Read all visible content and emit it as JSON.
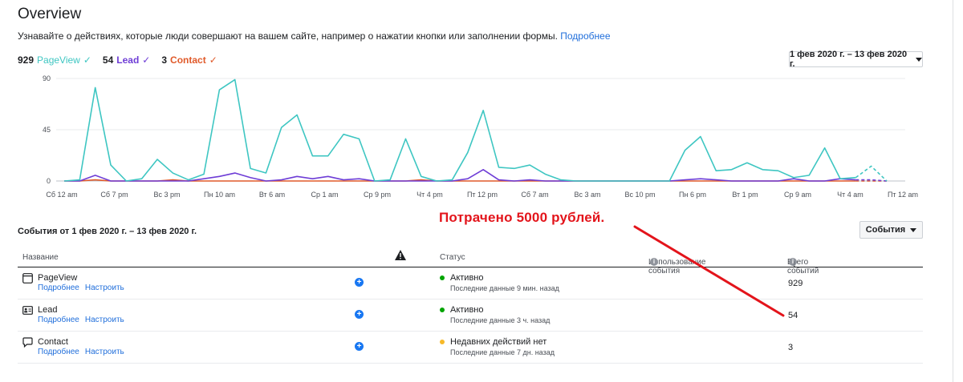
{
  "header": {
    "title": "Overview",
    "subtitle": "Узнавайте о действиях, которые люди совершают на вашем сайте, например о нажатии кнопки или заполнении формы.",
    "more_link": "Подробнее"
  },
  "legend": [
    {
      "count": "929",
      "name": "PageView",
      "check": "✓",
      "color": "#3ec6c2"
    },
    {
      "count": "54",
      "name": "Lead",
      "check": "✓",
      "color": "#6e3dd6"
    },
    {
      "count": "3",
      "name": "Contact",
      "check": "✓",
      "color": "#e05a2a"
    }
  ],
  "date_range": {
    "label": "1 фев 2020 г. – 13 фев 2020 г."
  },
  "chart_data": {
    "type": "line",
    "x_tick_labels": [
      "Сб 12 am",
      "Сб 7 pm",
      "Вс 3 pm",
      "Пн 10 am",
      "Вт 6 am",
      "Ср 1 am",
      "Ср 9 pm",
      "Чт 4 pm",
      "Пт 12 pm",
      "Сб 7 am",
      "Вс 3 am",
      "Вс 10 pm",
      "Пн 6 pm",
      "Вт 1 pm",
      "Ср 9 am",
      "Чт 4 am",
      "Пт 12 am"
    ],
    "y_ticks": [
      0,
      45,
      90
    ],
    "ylim": [
      0,
      90
    ],
    "series": [
      {
        "name": "PageView",
        "color": "#3ec6c2",
        "values": [
          0,
          1,
          82,
          14,
          0,
          2,
          19,
          7,
          1,
          6,
          80,
          89,
          11,
          7,
          47,
          58,
          22,
          22,
          41,
          37,
          0,
          1,
          37,
          4,
          0,
          1,
          25,
          62,
          12,
          11,
          14,
          6,
          1,
          0,
          0,
          0,
          0,
          0,
          0,
          0,
          27,
          39,
          9,
          10,
          16,
          10,
          9,
          3,
          5,
          29,
          2,
          3,
          13,
          0
        ],
        "dashed_from": 51
      },
      {
        "name": "Lead",
        "color": "#6e3dd6",
        "values": [
          0,
          0,
          5,
          0,
          0,
          0,
          0,
          0,
          0,
          2,
          4,
          7,
          3,
          0,
          1,
          4,
          2,
          4,
          1,
          2,
          0,
          0,
          0,
          0,
          0,
          0,
          2,
          10,
          1,
          0,
          1,
          0,
          0,
          0,
          0,
          0,
          0,
          0,
          0,
          0,
          1,
          2,
          1,
          0,
          0,
          0,
          0,
          2,
          0,
          0,
          2,
          1,
          1,
          0
        ],
        "dashed_from": 51
      },
      {
        "name": "Contact",
        "color": "#e05a2a",
        "values": [
          0,
          0,
          1,
          0,
          0,
          0,
          0,
          1,
          0,
          0,
          0,
          0,
          0,
          0,
          0,
          0,
          0,
          0,
          0,
          0,
          0,
          0,
          0,
          1,
          0,
          0,
          0,
          0,
          0,
          0,
          0,
          0,
          0,
          0,
          0,
          0,
          0,
          0,
          0,
          0,
          0,
          0,
          0,
          0,
          0,
          0,
          0,
          0,
          0,
          0,
          0,
          0,
          0,
          0
        ],
        "dashed_from": 51
      }
    ],
    "grid": true
  },
  "events": {
    "heading": "События от 1 фев 2020 г. – 13 фев 2020 г.",
    "button_label": "События",
    "columns": {
      "name": "Название",
      "status": "Статус",
      "usage": "Использование события",
      "total": "Всего событий"
    },
    "rows": [
      {
        "name": "PageView",
        "link_more": "Подробнее",
        "link_setup": "Настроить",
        "status": "Активно",
        "status_color": "#00a400",
        "status_sub": "Последние данные 9 мин. назад",
        "total": "929",
        "icon": "page-icon"
      },
      {
        "name": "Lead",
        "link_more": "Подробнее",
        "link_setup": "Настроить",
        "status": "Активно",
        "status_color": "#00a400",
        "status_sub": "Последние данные 3 ч. назад",
        "total": "54",
        "icon": "contact-card-icon"
      },
      {
        "name": "Contact",
        "link_more": "Подробнее",
        "link_setup": "Настроить",
        "status": "Недавних действий нет",
        "status_color": "#f7b928",
        "status_sub": "Последние данные 7 дн. назад",
        "total": "3",
        "icon": "chat-bubble-icon"
      }
    ]
  },
  "annotation": {
    "text": "Потрачено 5000 рублей.",
    "color": "#e3141b"
  }
}
